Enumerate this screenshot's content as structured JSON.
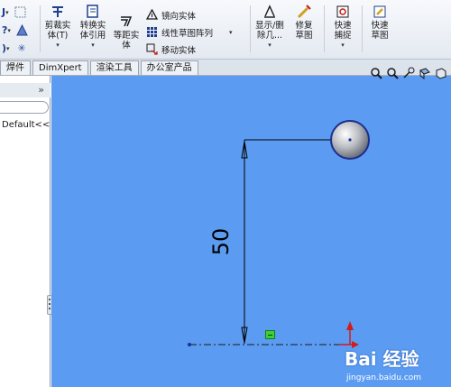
{
  "toolbar": {
    "trim_label": "剪裁实体(T)",
    "convert_label": "转换实体引用",
    "offset_label": "等距实体",
    "mirror_label": "镜向实体",
    "linear_pattern_label": "线性草图阵列",
    "move_label": "移动实体",
    "display_delete_label": "显示/删除几...",
    "repair_label": "修复草图",
    "quick_snap_label": "快速捕捉",
    "quick_sketch_label": "快速草图"
  },
  "tabs": [
    "焊件",
    "DimXpert",
    "渲染工具",
    "办公室产品"
  ],
  "left_panel": {
    "collapse_glyph": "»",
    "config_text": "Default<<"
  },
  "canvas": {
    "dimension_value": "50",
    "background_color": "#5b9cf2"
  },
  "watermark": {
    "logo_text": "Bai 经验",
    "url": "jingyan.baidu.com"
  }
}
